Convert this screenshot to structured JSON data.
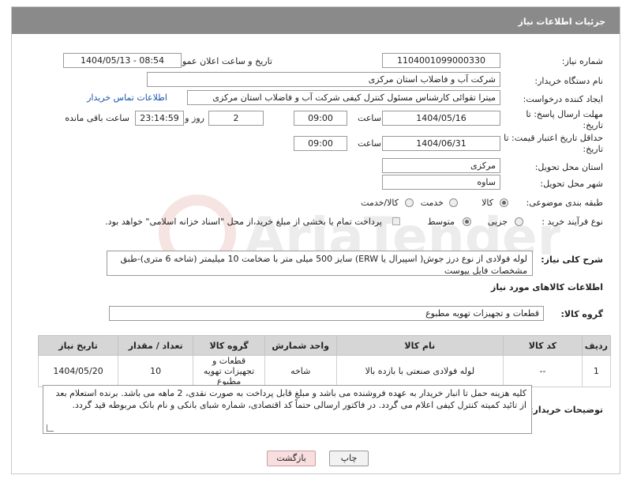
{
  "header": {
    "title": "جزئیات اطلاعات نیاز"
  },
  "form": {
    "need_number": {
      "label": "شماره نیاز:",
      "value": "1104001099000330"
    },
    "announce_datetime": {
      "label": "تاریخ و ساعت اعلان عمومی:",
      "value": "1404/05/13 - 08:54"
    },
    "buyer_org": {
      "label": "نام دستگاه خریدار:",
      "value": "شرکت آب و فاضلاب استان مرکزی"
    },
    "requester": {
      "label": "ایجاد کننده درخواست:",
      "value": "میترا تقوائی کارشناس مسئول کنترل کیفی شرکت آب و فاضلاب استان مرکزی",
      "contact_link": "اطلاعات تماس خریدار"
    },
    "reply_deadline": {
      "label": "مهلت ارسال پاسخ: تا تاریخ:",
      "date": "1404/05/16",
      "time_label": "ساعت",
      "time": "09:00",
      "days": "2",
      "days_label": "روز و",
      "remaining": "23:14:59",
      "remaining_label": "ساعت باقی مانده"
    },
    "price_validity": {
      "label": "حداقل تاریخ اعتبار قیمت: تا تاریخ:",
      "date": "1404/06/31",
      "time_label": "ساعت",
      "time": "09:00"
    },
    "delivery_province": {
      "label": "استان محل تحویل:",
      "value": "مرکزی"
    },
    "delivery_city": {
      "label": "شهر محل تحویل:",
      "value": "ساوه"
    },
    "subject_class": {
      "label": "طبقه بندی موضوعی:",
      "options": [
        "کالا",
        "خدمت",
        "کالا/خدمت"
      ],
      "selected": "کالا"
    },
    "purchase_process": {
      "label": "نوع فرآیند خرید :",
      "options": [
        "جزیی",
        "متوسط"
      ],
      "selected": "متوسط",
      "note": "پرداخت تمام یا بخشی از مبلغ خرید،از محل \"اسناد خزانه اسلامی\" خواهد بود."
    },
    "description": {
      "label": "شرح کلی نیاز:",
      "value": "لوله فولادی از نوع درز جوش( اسپیرال یا ERW) سایز 500 میلی متر با ضخامت 10 میلیمتر (شاخه 6 متری)-طبق مشخصات فایل پیوست"
    }
  },
  "goods": {
    "section_title": "اطلاعات کالاهای مورد نیاز",
    "group_label": "گروه کالا:",
    "group_value": "قطعات و تجهیزات تهویه مطبوع",
    "columns": [
      "ردیف",
      "کد کالا",
      "نام کالا",
      "واحد شمارش",
      "گروه کالا",
      "تعداد / مقدار",
      "تاریخ نیاز"
    ],
    "rows": [
      [
        "1",
        "--",
        "لوله فولادی صنعتی با بازده بالا",
        "شاخه",
        "قطعات و تجهیزات تهویه مطبوع",
        "10",
        "1404/05/20"
      ]
    ]
  },
  "buyer_notes": {
    "label": "توضیحات خریدار:",
    "value": "کلیه هزینه حمل تا انبار خریدار به عهده فروشنده می باشد و مبلغ قابل پرداخت به صورت نقدی، 2 ماهه می باشد. برنده استعلام بعد از تائید کمیته کنترل کیفی اعلام می گردد. در فاکتور ارسالی حتماً کد اقتصادی، شماره شبای بانکی و نام بانک مربوطه قید گردد."
  },
  "buttons": {
    "print": "چاپ",
    "back": "بازگشت"
  },
  "watermark": {
    "text": "AriaTender.neT"
  }
}
